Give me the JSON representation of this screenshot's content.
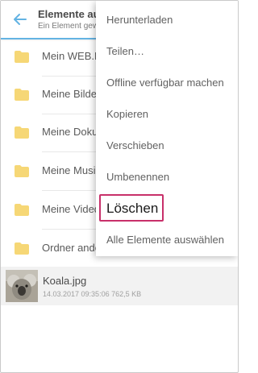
{
  "header": {
    "title": "Elemente au",
    "subtitle": "Ein Element gew",
    "back_icon": "arrow-back-icon"
  },
  "folders": [
    {
      "label": "Mein WEB.D",
      "icon": "folder-icon"
    },
    {
      "label": "Meine Bilde",
      "icon": "folder-icon"
    },
    {
      "label": "Meine Doku",
      "icon": "folder-icon"
    },
    {
      "label": "Meine Musi",
      "icon": "folder-icon"
    },
    {
      "label": "Meine Vided",
      "icon": "folder-icon"
    },
    {
      "label": "Ordner ande",
      "icon": "folder-icon"
    }
  ],
  "file": {
    "name": "Koala.jpg",
    "meta": "14.03.2017 09:35:06 762,5 KB"
  },
  "context_menu": {
    "items": [
      "Herunterladen",
      "Teilen…",
      "Offline verfügbar machen",
      "Kopieren",
      "Verschieben",
      "Umbenennen",
      "Löschen",
      "Alle Elemente auswählen"
    ],
    "highlighted_item": "Löschen"
  },
  "colors": {
    "accent": "#63b3e3",
    "folder": "#f6d776",
    "highlight_border": "#c8306a"
  }
}
